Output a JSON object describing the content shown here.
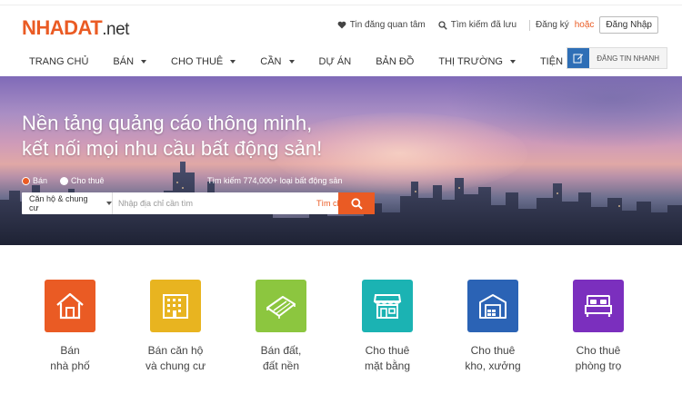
{
  "header": {
    "logo_brand": "NHADAT",
    "logo_tld": ".net",
    "saved_posts": "Tin đăng quan tâm",
    "saved_searches": "Tìm kiếm đã lưu",
    "register": "Đăng ký",
    "or": "hoặc",
    "login": "Đăng Nhập"
  },
  "nav": {
    "items": [
      {
        "label": "TRANG CHỦ",
        "dropdown": false
      },
      {
        "label": "BÁN",
        "dropdown": true
      },
      {
        "label": "CHO THUÊ",
        "dropdown": true
      },
      {
        "label": "CẦN",
        "dropdown": true
      },
      {
        "label": "DỰ ÁN",
        "dropdown": false
      },
      {
        "label": "BẢN ĐỒ",
        "dropdown": false
      },
      {
        "label": "THỊ TRƯỜNG",
        "dropdown": true
      },
      {
        "label": "TIỆN ÍCH",
        "dropdown": true
      }
    ],
    "post_button": "ĐĂNG TIN NHANH"
  },
  "hero": {
    "tagline_line1": "Nền tảng quảng cáo thông minh,",
    "tagline_line2": "kết nối mọi nhu cầu bất động sản!",
    "radio_sell": "Bán",
    "radio_rent": "Cho thuê",
    "selected": "sell",
    "search_count": "Tìm kiếm 774,000+ loại bất động sản",
    "property_type": "Căn hộ & chung cư",
    "address_placeholder": "Nhập địa chỉ cần tìm",
    "detail_search": "Tìm chi tiết"
  },
  "categories": [
    {
      "line1": "Bán",
      "line2": "nhà phố",
      "color": "#ea5b24",
      "icon": "house-icon"
    },
    {
      "line1": "Bán căn hộ",
      "line2": "và chung cư",
      "color": "#e8b420",
      "icon": "apartment-icon"
    },
    {
      "line1": "Bán đất,",
      "line2": "đất nền",
      "color": "#8cc63f",
      "icon": "land-icon"
    },
    {
      "line1": "Cho thuê",
      "line2": "mặt bằng",
      "color": "#1bb3b3",
      "icon": "storefront-icon"
    },
    {
      "line1": "Cho thuê",
      "line2": "kho, xưởng",
      "color": "#2b63b5",
      "icon": "warehouse-icon"
    },
    {
      "line1": "Cho thuê",
      "line2": "phòng trọ",
      "color": "#7b2fbe",
      "icon": "bed-icon"
    }
  ]
}
